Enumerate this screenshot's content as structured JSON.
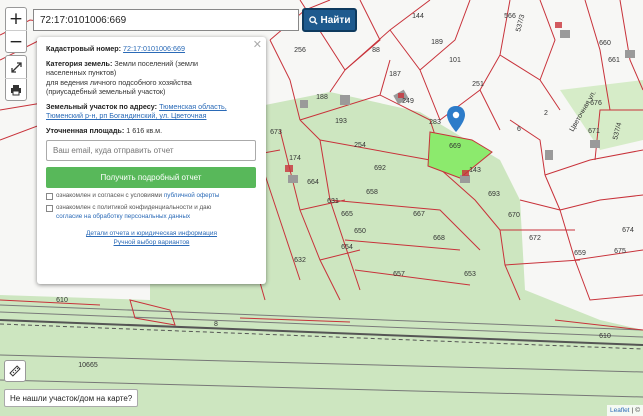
{
  "search": {
    "value": "72:17:0101006:669",
    "button_label": "Найти"
  },
  "zoom": {
    "in": "+",
    "out": "−"
  },
  "popup": {
    "cad_key": "Кадастровый номер:",
    "cad_val": "72:17:0101006:669",
    "cat_key": "Категория земель:",
    "cat_line1": "Земли поселений (земли",
    "cat_line2": "населенных пунктов)",
    "cat_line3": "для ведения личного подсобного хозяйства",
    "cat_line4": "(приусадебный земельный участок)",
    "addr_key": "Земельный участок по адресу:",
    "addr_line1": "Тюменская область,",
    "addr_line2": "Тюменский р-н, рп Богандинский, ул. Цветочная",
    "area_key": "Уточненная площадь:",
    "area_val": "1 616 кв.м.",
    "email_placeholder": "Ваш email, куда отправить отчет",
    "button_label": "Получить подробный отчет",
    "consent1_text": "ознакомлен и согласен с условиями",
    "consent1_link": "публичной оферты",
    "consent2_text": "ознакомлен с политикой конфиденциальности и даю",
    "consent2_link": "согласие на обработку персональных данных",
    "footer1": "Детали отчета и юридическая информация",
    "footer2": "Ручной выбор вариантов"
  },
  "not_found": "Не нашли участок/дом на карте?",
  "attribution": {
    "leaflet": "Leaflet",
    "sep": "|",
    "rest": "©"
  },
  "colors": {
    "green_area": "#cde6c0",
    "selected": "#8cea6d",
    "boundary": "#c8323a",
    "road": "#6e6e6e",
    "button": "#1e5a8e"
  },
  "parcels": [
    {
      "label": "669",
      "selected": true
    },
    {
      "label": "256"
    },
    {
      "label": "88"
    },
    {
      "label": "144"
    },
    {
      "label": "189"
    },
    {
      "label": "101"
    },
    {
      "label": "566"
    },
    {
      "label": "660"
    },
    {
      "label": "661"
    },
    {
      "label": "187"
    },
    {
      "label": "249"
    },
    {
      "label": "251"
    },
    {
      "label": "188"
    },
    {
      "label": "193"
    },
    {
      "label": "283"
    },
    {
      "label": "6"
    },
    {
      "label": "2"
    },
    {
      "label": "676"
    },
    {
      "label": "671"
    },
    {
      "label": "673"
    },
    {
      "label": "254"
    },
    {
      "label": "174"
    },
    {
      "label": "664"
    },
    {
      "label": "692"
    },
    {
      "label": "143"
    },
    {
      "label": "693"
    },
    {
      "label": "658"
    },
    {
      "label": "631"
    },
    {
      "label": "665"
    },
    {
      "label": "650"
    },
    {
      "label": "654"
    },
    {
      "label": "667"
    },
    {
      "label": "670"
    },
    {
      "label": "672"
    },
    {
      "label": "668"
    },
    {
      "label": "632"
    },
    {
      "label": "657"
    },
    {
      "label": "653"
    },
    {
      "label": "675"
    },
    {
      "label": "674"
    },
    {
      "label": "659"
    },
    {
      "label": "610"
    },
    {
      "label": "610"
    },
    {
      "label": "10665"
    },
    {
      "label": "8"
    }
  ],
  "streets": [
    "Цветочная ул.",
    "537/3",
    "537/4"
  ]
}
